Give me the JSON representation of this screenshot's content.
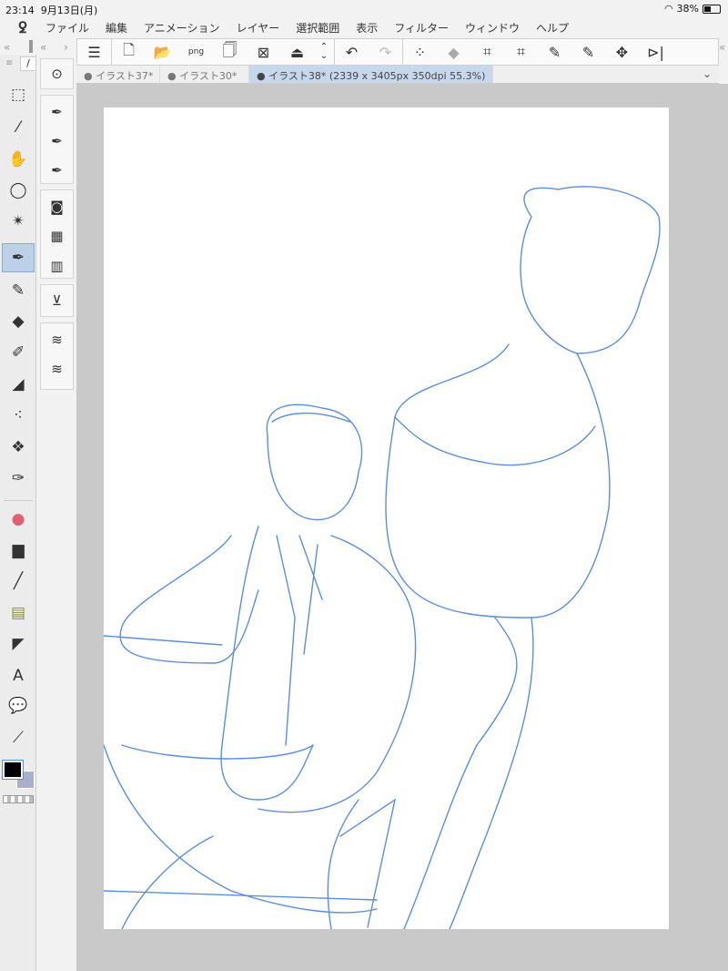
{
  "status": {
    "time": "23:14",
    "date": "9月13日(月)",
    "battery": "38%"
  },
  "menu": [
    "ファイル",
    "編集",
    "アニメーション",
    "レイヤー",
    "選択範囲",
    "表示",
    "フィルター",
    "ウィンドウ",
    "ヘルプ"
  ],
  "tabs": [
    {
      "label": "● イラスト37*"
    },
    {
      "label": "● イラスト30*"
    },
    {
      "label": "● イラスト38* (2339 x 3405px 350dpi 55.3%)"
    }
  ],
  "colors": {
    "main": "#000000",
    "sub": "#a8b0cc",
    "line": "#5a8ee0",
    "selected_tool": "#bcd0e8"
  },
  "toolbar_icons": [
    "menu-icon",
    "new-canvas-icon",
    "open-icon",
    "export-png-icon",
    "save-icon",
    "fit-icon",
    "import-icon",
    "stepper-icon",
    "undo-icon",
    "redo-icon",
    "deselect-icon",
    "fill-icon",
    "transform-icon",
    "free-transform-icon",
    "pen-icon",
    "pen2-icon",
    "move-icon",
    "flip-icon"
  ],
  "left_tools": [
    "operation",
    "eyedropper",
    "hand",
    "lasso",
    "auto-select",
    "pen",
    "pencil",
    "eraser",
    "brush",
    "marker",
    "airbrush",
    "decoration",
    "blend",
    "fill",
    "gradient",
    "line",
    "frame",
    "ruler",
    "text",
    "balloon",
    "correct-line"
  ]
}
